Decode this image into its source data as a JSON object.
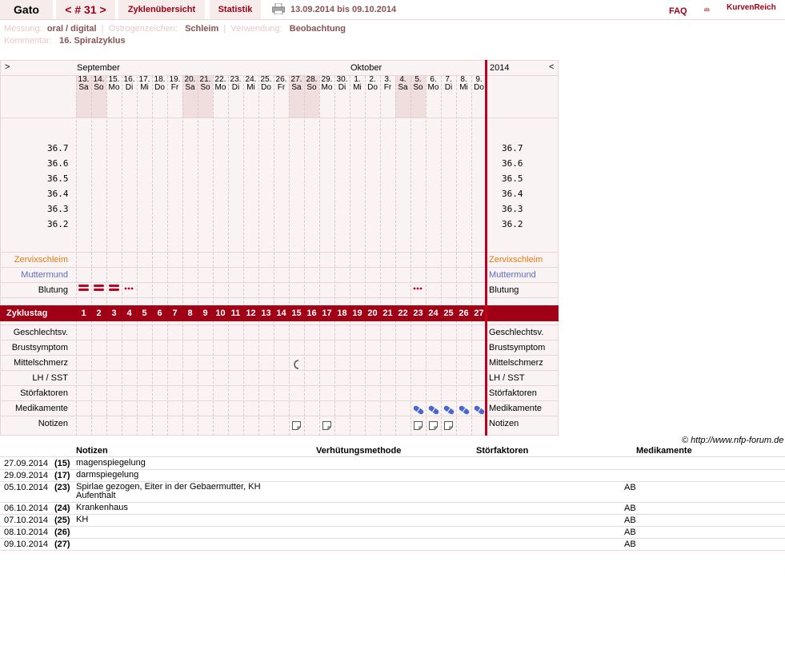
{
  "topbar": {
    "name": "Gato",
    "cycle": "< # 31 >",
    "tab_overview": "Zyklenübersicht",
    "tab_stats": "Statistik",
    "date_range": "13.09.2014 bis 09.10.2014",
    "faq": "FAQ",
    "logo": "KurvenReich"
  },
  "info": {
    "measure_label": "Messung:",
    "measure_value": "oral / digital",
    "estrogen_label": "Östrogenzeichen:",
    "estrogen_value": "Schleim",
    "use_label": "Verwendung:",
    "use_value": "Beobachtung",
    "comment_label": "Kommentar:",
    "comment_value": "16. Spiralzyklus"
  },
  "chart": {
    "nav_left": ">",
    "nav_right": "<",
    "month1": "September",
    "month2": "Oktober",
    "year": "2014",
    "days": [
      {
        "d": "13.",
        "w": "Sa"
      },
      {
        "d": "14.",
        "w": "So"
      },
      {
        "d": "15.",
        "w": "Mo"
      },
      {
        "d": "16.",
        "w": "Di"
      },
      {
        "d": "17.",
        "w": "Mi"
      },
      {
        "d": "18.",
        "w": "Do"
      },
      {
        "d": "19.",
        "w": "Fr"
      },
      {
        "d": "20.",
        "w": "Sa"
      },
      {
        "d": "21.",
        "w": "So"
      },
      {
        "d": "22.",
        "w": "Mo"
      },
      {
        "d": "23.",
        "w": "Di"
      },
      {
        "d": "24.",
        "w": "Mi"
      },
      {
        "d": "25.",
        "w": "Do"
      },
      {
        "d": "26.",
        "w": "Fr"
      },
      {
        "d": "27.",
        "w": "Sa"
      },
      {
        "d": "28.",
        "w": "So"
      },
      {
        "d": "29.",
        "w": "Mo"
      },
      {
        "d": "30.",
        "w": "Di"
      },
      {
        "d": "1.",
        "w": "Mi"
      },
      {
        "d": "2.",
        "w": "Do"
      },
      {
        "d": "3.",
        "w": "Fr"
      },
      {
        "d": "4.",
        "w": "Sa"
      },
      {
        "d": "5.",
        "w": "So"
      },
      {
        "d": "6.",
        "w": "Mo"
      },
      {
        "d": "7.",
        "w": "Di"
      },
      {
        "d": "8.",
        "w": "Mi"
      },
      {
        "d": "9.",
        "w": "Do"
      }
    ],
    "weekend_indices": [
      0,
      1,
      7,
      8,
      14,
      15,
      21,
      22
    ],
    "temps": [
      "36.7",
      "36.6",
      "36.5",
      "36.4",
      "36.3",
      "36.2"
    ],
    "labels": {
      "zervix": "Zervixschleim",
      "mutter": "Muttermund",
      "blutung": "Blutung",
      "zyklustag": "Zyklustag",
      "gv": "Geschlechtsv.",
      "brust": "Brustsymptom",
      "mittel": "Mittelschmerz",
      "lh": "LH / SST",
      "stoer": "Störfaktoren",
      "med": "Medikamente",
      "notizen": "Notizen"
    },
    "cycle_days": [
      "1",
      "2",
      "3",
      "4",
      "5",
      "6",
      "7",
      "8",
      "9",
      "10",
      "11",
      "12",
      "13",
      "14",
      "15",
      "16",
      "17",
      "18",
      "19",
      "20",
      "21",
      "22",
      "23",
      "24",
      "25",
      "26",
      "27"
    ],
    "bleeding_heavy": [
      0,
      1,
      2
    ],
    "bleeding_spot": [
      3,
      22
    ],
    "mittelschmerz": [
      14
    ],
    "medikamente": [
      22,
      23,
      24,
      25,
      26
    ],
    "notizen": [
      14,
      16,
      22,
      23,
      24
    ],
    "colors": {
      "accent": "#a00016",
      "zervix": "#e07b10",
      "mutter": "#5a6fc4",
      "pill": "#4a66d0"
    }
  },
  "copyright": "© http://www.nfp-forum.de",
  "notes": {
    "headers": {
      "notizen": "Notizen",
      "methode": "Verhütungsmethode",
      "stoer": "Störfaktoren",
      "med": "Medikamente"
    },
    "rows": [
      {
        "date": "27.09.2014",
        "day": "(15)",
        "note": "magenspiegelung",
        "med": ""
      },
      {
        "date": "29.09.2014",
        "day": "(17)",
        "note": "darmspiegelung",
        "med": ""
      },
      {
        "date": "05.10.2014",
        "day": "(23)",
        "note": "Spirlae gezogen, Eiter in der Gebaermutter, KH",
        "note2": "Aufenthalt",
        "med": "AB"
      },
      {
        "date": "06.10.2014",
        "day": "(24)",
        "note": "Krankenhaus",
        "med": "AB"
      },
      {
        "date": "07.10.2014",
        "day": "(25)",
        "note": "KH",
        "med": "AB"
      },
      {
        "date": "08.10.2014",
        "day": "(26)",
        "note": "",
        "med": "AB"
      },
      {
        "date": "09.10.2014",
        "day": "(27)",
        "note": "",
        "med": "AB"
      }
    ]
  }
}
